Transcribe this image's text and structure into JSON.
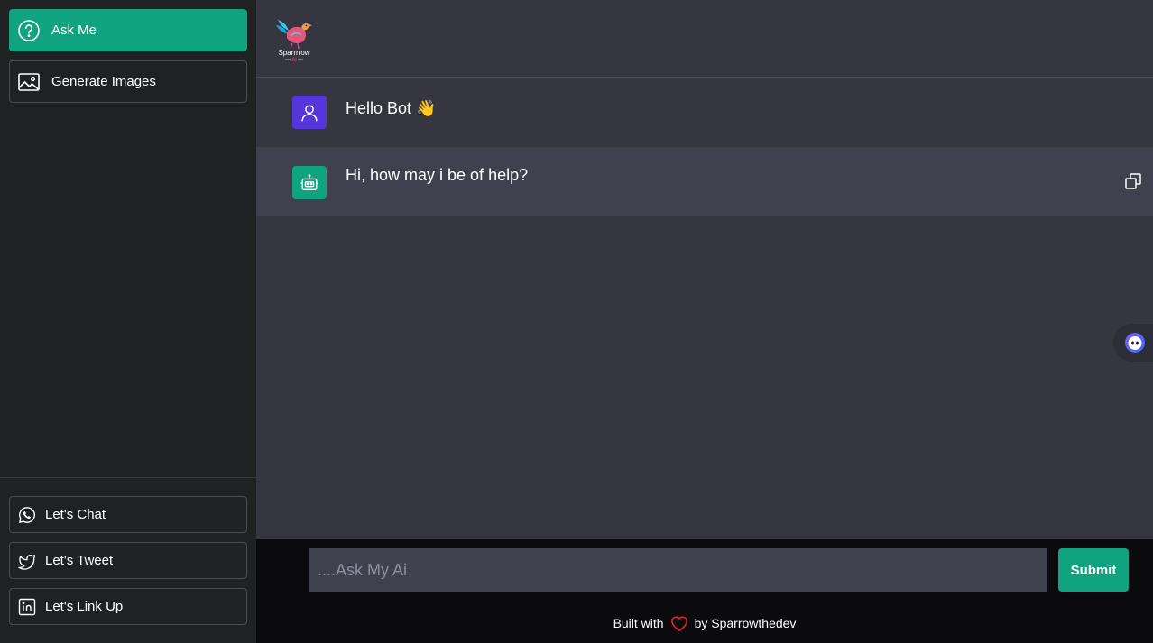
{
  "sidebar": {
    "top_items": [
      {
        "label": "Ask Me",
        "icon": "question-circle-icon",
        "active": true
      },
      {
        "label": "Generate Images",
        "icon": "image-icon",
        "active": false
      }
    ],
    "social_items": [
      {
        "label": "Let's Chat",
        "icon": "whatsapp-icon"
      },
      {
        "label": "Let's Tweet",
        "icon": "twitter-icon"
      },
      {
        "label": "Let's Link Up",
        "icon": "linkedin-icon"
      }
    ]
  },
  "header": {
    "logo_text": "Sparrrrow",
    "logo_subtext": "Ai"
  },
  "messages": [
    {
      "role": "user",
      "text": "Hello Bot 👋",
      "avatar_icon": "user-icon"
    },
    {
      "role": "bot",
      "text": "Hi, how may i be of help?",
      "avatar_icon": "robot-icon",
      "action_icon": "copy-icon"
    }
  ],
  "composer": {
    "placeholder": "....Ask My Ai",
    "submit_label": "Submit"
  },
  "footer": {
    "prefix": "Built with",
    "suffix": "by Sparrowthedev",
    "icon": "heart-icon"
  },
  "colors": {
    "accent": "#10a37f",
    "user_avatar": "#5436da",
    "sidebar_bg": "#202123",
    "main_bg": "#363641",
    "bot_row_bg": "#40414f",
    "heart": "#e0202a"
  }
}
